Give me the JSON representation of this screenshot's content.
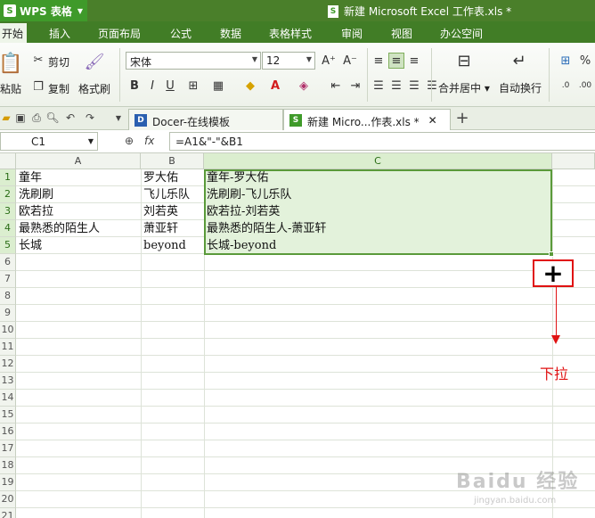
{
  "titlebar": {
    "app_name": "WPS 表格",
    "doc_title": "新建 Microsoft Excel 工作表.xls *",
    "bg_color": "#4a7f2a"
  },
  "menu": {
    "tabs": [
      {
        "label": "开始"
      },
      {
        "label": "插入"
      },
      {
        "label": "页面布局"
      },
      {
        "label": "公式"
      },
      {
        "label": "数据"
      },
      {
        "label": "表格样式"
      },
      {
        "label": "审阅"
      },
      {
        "label": "视图"
      },
      {
        "label": "办公空间"
      }
    ]
  },
  "ribbon": {
    "paste_label": "粘贴",
    "cut_label": "剪切",
    "copy_label": "复制",
    "format_painter_label": "格式刷",
    "font_name": "宋体",
    "font_size": "12",
    "merge_center_label": "合并居中",
    "wrap_text_label": "自动换行"
  },
  "doc_tabs": [
    {
      "label": "Docer-在线模板"
    },
    {
      "label": "新建 Micro...作表.xls *"
    }
  ],
  "formula_bar": {
    "cell_ref": "C1",
    "fx_label": "fx",
    "formula": "=A1&\"-\"&B1"
  },
  "grid": {
    "columns": [
      {
        "label": "A"
      },
      {
        "label": "B"
      },
      {
        "label": "C"
      }
    ],
    "row_numbers": [
      "1",
      "2",
      "3",
      "4",
      "5",
      "6",
      "7",
      "8",
      "9",
      "10",
      "11",
      "12",
      "13",
      "14",
      "15",
      "16",
      "17",
      "18",
      "19",
      "20",
      "21"
    ],
    "rows": [
      [
        "童年",
        "罗大佑",
        "童年-罗大佑"
      ],
      [
        "洗刷刷",
        "飞儿乐队",
        "洗刷刷-飞儿乐队"
      ],
      [
        "欧若拉",
        "刘若英",
        "欧若拉-刘若英"
      ],
      [
        "最熟悉的陌生人",
        "萧亚轩",
        "最熟悉的陌生人-萧亚轩"
      ],
      [
        "长城",
        "beyond",
        "长城-beyond"
      ]
    ]
  },
  "annotation": {
    "symbol": "+",
    "text": "下拉",
    "color": "#e01212"
  },
  "watermark": {
    "main": "Baidu 经验",
    "sub": "jingyan.baidu.com"
  }
}
